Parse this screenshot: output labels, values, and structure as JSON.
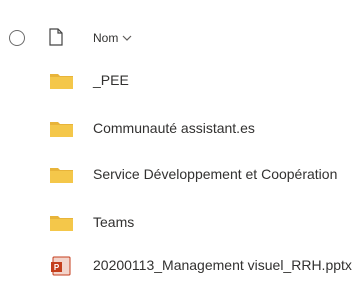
{
  "header": {
    "name_label": "Nom"
  },
  "items": [
    {
      "name": "_PEE",
      "type": "folder"
    },
    {
      "name": "Communauté assistant.es",
      "type": "folder"
    },
    {
      "name": "Service Développement et Coopération",
      "type": "folder"
    },
    {
      "name": "Teams",
      "type": "folder"
    },
    {
      "name": "20200113_Management visuel_RRH.pptx",
      "type": "pptx"
    }
  ],
  "colors": {
    "folder": "#f4c74a",
    "folder_dark": "#e8b43a",
    "pptx": "#c43e1c"
  }
}
